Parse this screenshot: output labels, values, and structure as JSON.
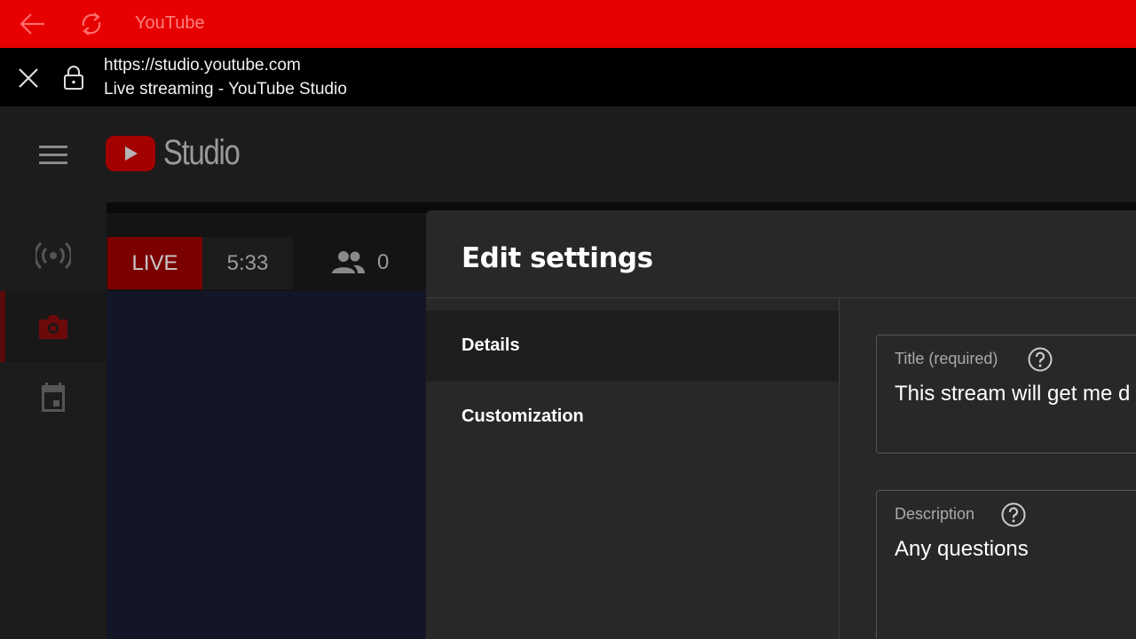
{
  "app_bar": {
    "title": "YouTube",
    "back_icon": "back-arrow-icon",
    "reload_icon": "reload-icon"
  },
  "url_bar": {
    "url": "https://studio.youtube.com",
    "page_title": "Live streaming - YouTube Studio"
  },
  "header": {
    "logo_text": "Studio"
  },
  "sidebar": {
    "items": [
      {
        "name": "stream",
        "icon": "broadcast-icon"
      },
      {
        "name": "webcam",
        "icon": "camera-icon",
        "active": true
      },
      {
        "name": "manage",
        "icon": "calendar-icon"
      }
    ]
  },
  "stream_status": {
    "live_label": "LIVE",
    "elapsed": "5:33",
    "viewers": "0"
  },
  "dialog": {
    "title": "Edit settings",
    "tabs": [
      {
        "label": "Details",
        "active": true
      },
      {
        "label": "Customization",
        "active": false
      }
    ],
    "fields": {
      "title": {
        "label": "Title (required)",
        "value": "This stream will get me d"
      },
      "description": {
        "label": "Description",
        "value": "Any questions"
      }
    }
  },
  "colors": {
    "app_bar": "#e60000",
    "accent_red": "#7b0000",
    "dialog_bg": "#282828"
  }
}
